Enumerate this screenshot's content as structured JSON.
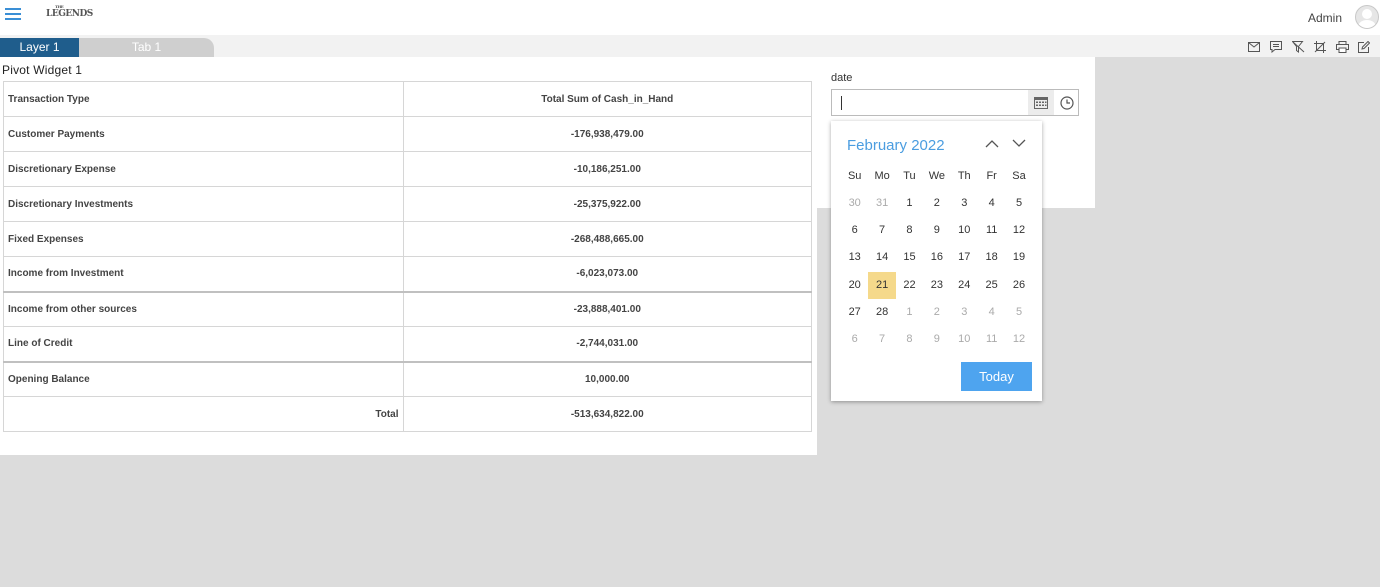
{
  "header": {
    "logo_text": "LEGENDS",
    "logo_small": "THE",
    "user_name": "Admin"
  },
  "tabs": [
    {
      "label": "Layer 1"
    },
    {
      "label": "Tab 1"
    }
  ],
  "toolbar_icons": [
    "mail-icon",
    "comment-icon",
    "filter-clear-icon",
    "crop-icon",
    "print-icon",
    "edit-icon"
  ],
  "widget": {
    "title": "Pivot Widget 1",
    "columns": [
      "Transaction Type",
      "Total Sum of Cash_in_Hand"
    ],
    "rows": [
      {
        "label": "Customer Payments",
        "value": "-176,938,479.00"
      },
      {
        "label": "Discretionary Expense",
        "value": "-10,186,251.00"
      },
      {
        "label": "Discretionary Investments",
        "value": "-25,375,922.00"
      },
      {
        "label": "Fixed Expenses",
        "value": "-268,488,665.00"
      },
      {
        "label": "Income from Investment",
        "value": "-6,023,073.00"
      },
      {
        "label": "Income from other sources",
        "value": "-23,888,401.00"
      },
      {
        "label": "Line of Credit",
        "value": "-2,744,031.00"
      },
      {
        "label": "Opening Balance",
        "value": "10,000.00"
      }
    ],
    "total": {
      "label": "Total",
      "value": "-513,634,822.00"
    }
  },
  "date_filter": {
    "label": "date",
    "value": "",
    "calendar": {
      "month_title": "February 2022",
      "weekdays": [
        "Su",
        "Mo",
        "Tu",
        "We",
        "Th",
        "Fr",
        "Sa"
      ],
      "weeks": [
        [
          "30",
          "31",
          "1",
          "2",
          "3",
          "4",
          "5"
        ],
        [
          "6",
          "7",
          "8",
          "9",
          "10",
          "11",
          "12"
        ],
        [
          "13",
          "14",
          "15",
          "16",
          "17",
          "18",
          "19"
        ],
        [
          "20",
          "21",
          "22",
          "23",
          "24",
          "25",
          "26"
        ],
        [
          "27",
          "28",
          "1",
          "2",
          "3",
          "4",
          "5"
        ],
        [
          "6",
          "7",
          "8",
          "9",
          "10",
          "11",
          "12"
        ]
      ],
      "selected_day": "21",
      "today_label": "Today"
    }
  },
  "colors": {
    "accent": "#4b9de0",
    "tab_active": "#1f5d8c",
    "selected_day": "#f5d98b",
    "today_button": "#4ea4ef"
  }
}
